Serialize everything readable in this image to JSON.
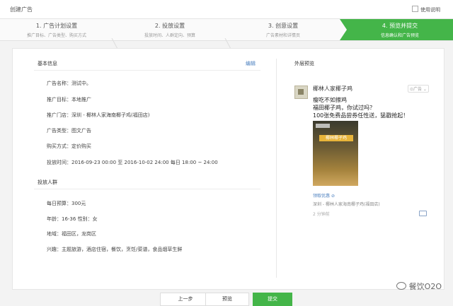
{
  "window": {
    "title": "创建广告",
    "help": "使用说明"
  },
  "steps": [
    {
      "title": "1. 广告计划设置",
      "sub": "推广目标、广告类型、购买方式"
    },
    {
      "title": "2. 投放设置",
      "sub": "投放时间、人群定向、预算"
    },
    {
      "title": "3. 创意设置",
      "sub": "广告素材和详情页"
    },
    {
      "title": "4. 预览并提交",
      "sub": "信息确认和广告预览"
    }
  ],
  "basic": {
    "title": "基本信息",
    "edit": "编辑",
    "rows": [
      "广告名称：测试中。",
      "推广目标：本地推广",
      "推广门店：深圳 - 椰林人家海南椰子鸡(福田店)",
      "广告类型：图文广告",
      "购买方式：定价购买",
      "投放时间：2016-09-23 00:00 至 2016-10-02 24:00    每日 18:00 ~ 24:00"
    ]
  },
  "audience": {
    "title": "投放人群",
    "rows": [
      "每日预算：300元",
      "年龄：16-36      性别：女",
      "地域：福田区，龙岗区",
      "兴趣：主题旅游，酒店住宿，餐饮，烹饪/菜谱，食品烟草生鲜"
    ]
  },
  "preview": {
    "title": "外层预览",
    "account": "椰林人家椰子鸡",
    "ad_tag": "⊙广告 ⌄",
    "copy": "瘦吃不如擦鸡\n福田椰子鸡，你试过吗？\n100张免费品尝券任性送，猛戳抢起！",
    "banner": "椰林椰子鸡",
    "coupon": "领取优惠",
    "store": "深圳 - 椰林人家海南椰子鸡(福田店)",
    "time": "2 分钟前"
  },
  "buttons": {
    "prev": "上一步",
    "preview": "预览",
    "submit": "提交"
  },
  "watermark": "餐饮O2O"
}
